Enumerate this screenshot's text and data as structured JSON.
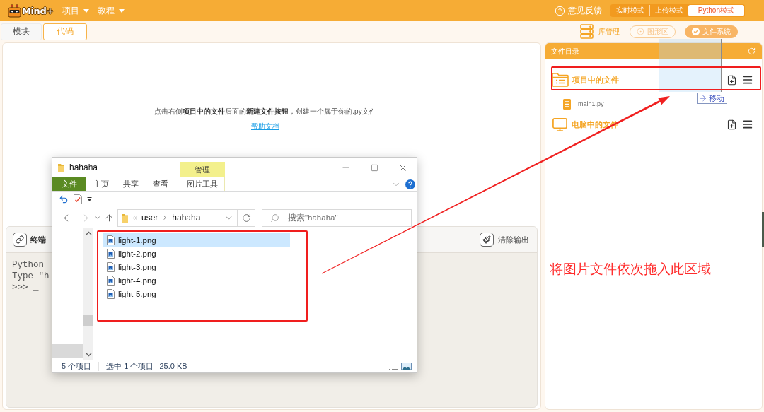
{
  "app_bar": {
    "logo": "Mind+",
    "menus": [
      {
        "label": "项目"
      },
      {
        "label": "教程"
      }
    ],
    "feedback": "意见反馈",
    "modes": [
      {
        "label": "实时模式",
        "selected": false
      },
      {
        "label": "上传模式",
        "selected": false
      },
      {
        "label": "Python模式",
        "selected": true
      }
    ]
  },
  "toolbar": {
    "tabs": [
      {
        "label": "模块",
        "selected": false
      },
      {
        "label": "代码",
        "selected": true
      }
    ],
    "library": "库管理",
    "view_buttons": [
      {
        "label": "图形区",
        "selected": false
      },
      {
        "label": "文件系统",
        "selected": true
      }
    ]
  },
  "editor": {
    "hint": "点击右侧**项目中的文件**后面的**新建文件按钮**，创建一个属于你的.py文件",
    "help_link": "帮助文档"
  },
  "terminal": {
    "title": "终端",
    "clear_button": "清除输出",
    "lines": [
      "Python",
      "Type \"h",
      ">>> _"
    ]
  },
  "file_panel": {
    "title": "文件目录",
    "sections": [
      {
        "kind": "project",
        "label": "项目中的文件",
        "files": [
          "main1.py"
        ]
      },
      {
        "kind": "computer",
        "label": "电脑中的文件"
      }
    ]
  },
  "explorer": {
    "title": "hahaha",
    "context_tab": "管理",
    "ribbon_tabs": [
      {
        "kind": "file",
        "label": "文件"
      },
      {
        "kind": "tab",
        "label": "主页"
      },
      {
        "kind": "tab",
        "label": "共享"
      },
      {
        "kind": "tab",
        "label": "查看"
      },
      {
        "kind": "context",
        "label": "图片工具"
      }
    ],
    "path": [
      "user",
      "hahaha"
    ],
    "search": {
      "placeholder": "搜索\"hahaha\""
    },
    "files": [
      {
        "name": "light-1.png",
        "selected": true
      },
      {
        "name": "light-2.png",
        "selected": false
      },
      {
        "name": "light-3.png",
        "selected": false
      },
      {
        "name": "light-4.png",
        "selected": false
      },
      {
        "name": "light-5.png",
        "selected": false
      }
    ],
    "status_bar": {
      "count": "5 个项目",
      "selection": "选中 1 个项目",
      "size": "25.0 KB"
    }
  },
  "annotations": {
    "note": "将图片文件依次拖入此区域",
    "drag_tooltip": "移动"
  }
}
